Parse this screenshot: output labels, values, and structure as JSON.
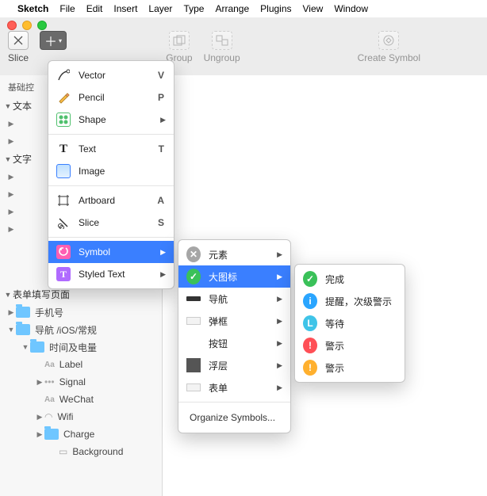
{
  "menubar": {
    "app": "Sketch",
    "items": [
      "File",
      "Edit",
      "Insert",
      "Layer",
      "Type",
      "Arrange",
      "Plugins",
      "View",
      "Window"
    ]
  },
  "toolbar": {
    "slice": "Slice",
    "group": "Group",
    "ungroup": "Ungroup",
    "create_symbol": "Create Symbol"
  },
  "sidebar": {
    "head1": "基础控",
    "sec1": "文本",
    "sec2": "文字",
    "head2": "表单填写页面",
    "items": {
      "phone": "手机号",
      "nav": "导航 /iOS/常规",
      "time": "时间及电量",
      "label": "Label",
      "signal": "Signal",
      "wechat": "WeChat",
      "wifi": "Wifi",
      "charge": "Charge",
      "bg": "Background"
    }
  },
  "menu1": [
    {
      "icon": "vector",
      "label": "Vector",
      "sc": "V"
    },
    {
      "icon": "pencil",
      "label": "Pencil",
      "sc": "P"
    },
    {
      "icon": "shape",
      "label": "Shape",
      "sub": true
    },
    {
      "sep": true
    },
    {
      "icon": "text",
      "label": "Text",
      "sc": "T"
    },
    {
      "icon": "image",
      "label": "Image"
    },
    {
      "sep": true
    },
    {
      "icon": "artboard",
      "label": "Artboard",
      "sc": "A"
    },
    {
      "icon": "slice",
      "label": "Slice",
      "sc": "S"
    },
    {
      "sep": true
    },
    {
      "icon": "symbol",
      "label": "Symbol",
      "sub": true,
      "sel": true
    },
    {
      "icon": "styled",
      "label": "Styled Text",
      "sub": true
    }
  ],
  "menu2": {
    "items": [
      {
        "dot": "gray",
        "glyph": "✕",
        "label": "元素"
      },
      {
        "dot": "green",
        "glyph": "✓",
        "label": "大图标",
        "sel": true
      },
      {
        "bar": true,
        "label": "导航"
      },
      {
        "thin": true,
        "label": "弹框"
      },
      {
        "blank": true,
        "label": "按钮"
      },
      {
        "box": true,
        "label": "浮层"
      },
      {
        "thin": true,
        "label": "表单"
      }
    ],
    "organize": "Organize Symbols..."
  },
  "menu3": [
    {
      "dot": "green",
      "glyph": "✓",
      "label": "完成"
    },
    {
      "dot": "blue",
      "glyph": "i",
      "label": "提醒，次级警示"
    },
    {
      "dot": "teal",
      "glyph": "L",
      "label": "等待"
    },
    {
      "dot": "red",
      "glyph": "!",
      "label": "警示"
    },
    {
      "dot": "yel",
      "glyph": "!",
      "label": "警示"
    }
  ]
}
